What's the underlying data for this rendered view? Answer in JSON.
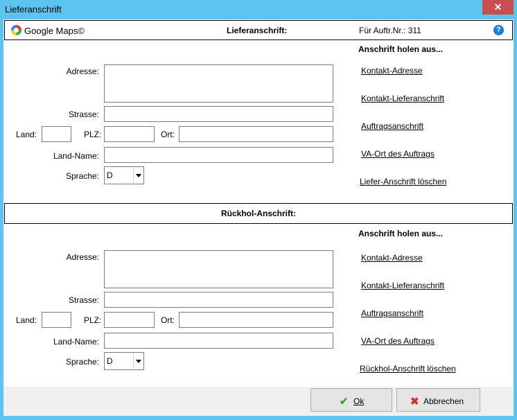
{
  "window": {
    "title": "Lieferanschrift",
    "close_symbol": "✕"
  },
  "header": {
    "maps_label": "Google Maps©",
    "title": "Lieferanschrift:",
    "order_text": "Für Auftr.Nr.: 311",
    "help_symbol": "?"
  },
  "delivery": {
    "labels": {
      "adresse": "Adresse:",
      "strasse": "Strasse:",
      "land": "Land:",
      "plz": "PLZ:",
      "ort": "Ort:",
      "land_name": "Land-Name:",
      "sprache": "Sprache:"
    },
    "values": {
      "adresse": "",
      "strasse": "",
      "land": "",
      "plz": "",
      "ort": "",
      "land_name": "",
      "sprache": "D"
    },
    "side_title": "Anschrift holen aus...",
    "links": [
      "Kontakt-Adresse",
      "Kontakt-Lieferanschrift",
      "Auftragsanschrift",
      "VA-Ort des Auftrags",
      "Liefer-Anschrift löschen"
    ]
  },
  "return": {
    "title": "Rückhol-Anschrift:",
    "labels": {
      "adresse": "Adresse:",
      "strasse": "Strasse:",
      "land": "Land:",
      "plz": "PLZ:",
      "ort": "Ort:",
      "land_name": "Land-Name:",
      "sprache": "Sprache:"
    },
    "values": {
      "adresse": "",
      "strasse": "",
      "land": "",
      "plz": "",
      "ort": "",
      "land_name": "",
      "sprache": "D"
    },
    "side_title": "Anschrift holen aus...",
    "links": [
      "Kontakt-Adresse",
      "Kontakt-Lieferanschrift",
      "Auftragsanschrift",
      "VA-Ort des Auftrags",
      "Rückhol-Anschrift löschen"
    ]
  },
  "footer": {
    "ok_label": "Ok",
    "cancel_label": "Abbrechen",
    "ok_icon": "✔",
    "cancel_icon": "✖"
  },
  "colors": {
    "titlebar": "#5cc4ee",
    "close": "#c74f50",
    "ok_icon": "#3aa233",
    "cancel_icon": "#d0322d",
    "help": "#1a7fd4"
  }
}
